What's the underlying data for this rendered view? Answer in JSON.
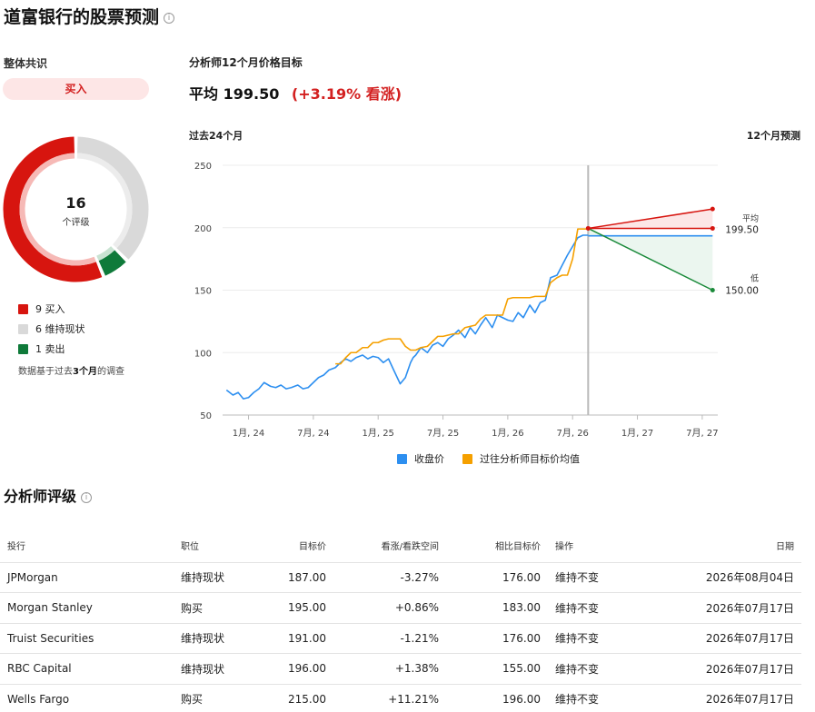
{
  "page": {
    "title": "道富银行的股票预测",
    "info_glyph": "i"
  },
  "consensus": {
    "label": "整体共识",
    "rating": "买入",
    "total": "16",
    "total_sub": "个评级",
    "breakdown": [
      {
        "label": "9 买入",
        "count": 9,
        "color": "#d7150f"
      },
      {
        "label": "6 维持现状",
        "count": 6,
        "color": "#d9d9d9"
      },
      {
        "label": "1 卖出",
        "count": 1,
        "color": "#0f7a3a"
      }
    ],
    "note_prefix": "数据基于过去",
    "note_bold": "3个月",
    "note_suffix": "的调查"
  },
  "target": {
    "title": "分析师12个月价格目标",
    "avg_label": "平均",
    "avg_value": "199.50",
    "avg_change": "(+3.19% 看涨)"
  },
  "chart_labels": {
    "past": "过去24个月",
    "forecast": "12个月预测"
  },
  "chart_data": {
    "type": "line",
    "ylim": [
      50,
      250
    ],
    "yticks": [
      "50",
      "100",
      "150",
      "200",
      "250"
    ],
    "xticks": [
      "1月, 24",
      "7月, 24",
      "1月, 25",
      "7月, 25",
      "1月, 26",
      "7月, 26",
      "1月, 27",
      "7月, 27"
    ],
    "series": [
      {
        "name": "收盘价",
        "color": "#2d8ff0",
        "x": [
          2023.83,
          2023.88,
          2023.92,
          2023.96,
          2024.0,
          2024.04,
          2024.08,
          2024.12,
          2024.17,
          2024.21,
          2024.25,
          2024.29,
          2024.33,
          2024.38,
          2024.42,
          2024.46,
          2024.5,
          2024.54,
          2024.58,
          2024.62,
          2024.67,
          2024.71,
          2024.75,
          2024.79,
          2024.83,
          2024.88,
          2024.92,
          2024.96,
          2025.0,
          2025.04,
          2025.08,
          2025.12,
          2025.17,
          2025.21,
          2025.25,
          2025.27,
          2025.29,
          2025.33,
          2025.38,
          2025.42,
          2025.46,
          2025.5,
          2025.54,
          2025.58,
          2025.62,
          2025.67,
          2025.71,
          2025.75,
          2025.79,
          2025.83,
          2025.88,
          2025.92,
          2025.96,
          2026.0,
          2026.04,
          2026.08,
          2026.12,
          2026.17,
          2026.21,
          2026.25,
          2026.29,
          2026.33,
          2026.38,
          2026.42,
          2026.46,
          2026.5,
          2026.54,
          2026.58,
          2026.62
        ],
        "y": [
          70,
          66,
          68,
          63,
          64,
          68,
          71,
          76,
          73,
          72,
          74,
          71,
          72,
          74,
          71,
          72,
          76,
          80,
          82,
          86,
          88,
          92,
          95,
          93,
          96,
          98,
          95,
          97,
          96,
          92,
          95,
          86,
          75,
          80,
          92,
          96,
          98,
          104,
          100,
          106,
          108,
          105,
          111,
          114,
          118,
          112,
          120,
          115,
          122,
          128,
          120,
          130,
          128,
          126,
          125,
          132,
          128,
          138,
          132,
          140,
          142,
          160,
          162,
          170,
          178,
          185,
          192,
          194,
          194
        ]
      },
      {
        "name": "过往分析师目标价均值",
        "color": "#f5a000",
        "x": [
          2024.67,
          2024.71,
          2024.75,
          2024.79,
          2024.83,
          2024.88,
          2024.92,
          2024.96,
          2025.0,
          2025.04,
          2025.08,
          2025.12,
          2025.17,
          2025.21,
          2025.25,
          2025.29,
          2025.33,
          2025.38,
          2025.42,
          2025.46,
          2025.5,
          2025.54,
          2025.58,
          2025.62,
          2025.67,
          2025.71,
          2025.75,
          2025.79,
          2025.83,
          2025.88,
          2025.92,
          2025.96,
          2026.0,
          2026.04,
          2026.08,
          2026.12,
          2026.17,
          2026.21,
          2026.25,
          2026.29,
          2026.33,
          2026.38,
          2026.42,
          2026.46,
          2026.5,
          2026.54,
          2026.58,
          2026.62
        ],
        "y": [
          91,
          91,
          96,
          100,
          100,
          104,
          104,
          108,
          108,
          110,
          111,
          111,
          111,
          105,
          102,
          102,
          104,
          105,
          109,
          113,
          113,
          114,
          115,
          115,
          120,
          121,
          122,
          127,
          130,
          130,
          130,
          130,
          143,
          144,
          144,
          144,
          144,
          145,
          145,
          145,
          156,
          160,
          162,
          162,
          175,
          199,
          199,
          199
        ]
      }
    ],
    "forecast": {
      "start_x": 2026.62,
      "start_y": 199.5,
      "end_x": 2027.58,
      "high": 215,
      "avg": 199.5,
      "low": 150,
      "current": 193.5,
      "avg_label": "平均",
      "avg_value": "199.50",
      "low_label": "低",
      "low_value": "150.00"
    },
    "colors": {
      "high": "#d7150f",
      "avg": "#d7150f",
      "low": "#1a8a3a",
      "current": "#2d8ff0"
    }
  },
  "section": {
    "title": "分析师评级"
  },
  "table": {
    "headers": [
      "投行",
      "职位",
      "目标价",
      "看涨/看跌空间",
      "相比目标价",
      "操作",
      "日期"
    ],
    "rows": [
      {
        "firm": "JPMorgan",
        "position": "维持现状",
        "pos_type": "hold",
        "target": "187.00",
        "upside": "-3.27%",
        "up_type": "neg",
        "prev": "176.00",
        "action": "维持不变",
        "date": "2026年08月04日"
      },
      {
        "firm": "Morgan Stanley",
        "position": "购买",
        "pos_type": "buy",
        "target": "195.00",
        "upside": "+0.86%",
        "up_type": "pos",
        "prev": "183.00",
        "action": "维持不变",
        "date": "2026年07月17日"
      },
      {
        "firm": "Truist Securities",
        "position": "维持现状",
        "pos_type": "hold",
        "target": "191.00",
        "upside": "-1.21%",
        "up_type": "neg",
        "prev": "176.00",
        "action": "维持不变",
        "date": "2026年07月17日"
      },
      {
        "firm": "RBC Capital",
        "position": "维持现状",
        "pos_type": "hold",
        "target": "196.00",
        "upside": "+1.38%",
        "up_type": "pos",
        "prev": "155.00",
        "action": "维持不变",
        "date": "2026年07月17日"
      },
      {
        "firm": "Wells Fargo",
        "position": "购买",
        "pos_type": "buy",
        "target": "215.00",
        "upside": "+11.21%",
        "up_type": "pos",
        "prev": "196.00",
        "action": "维持不变",
        "date": "2026年07月17日"
      }
    ]
  }
}
